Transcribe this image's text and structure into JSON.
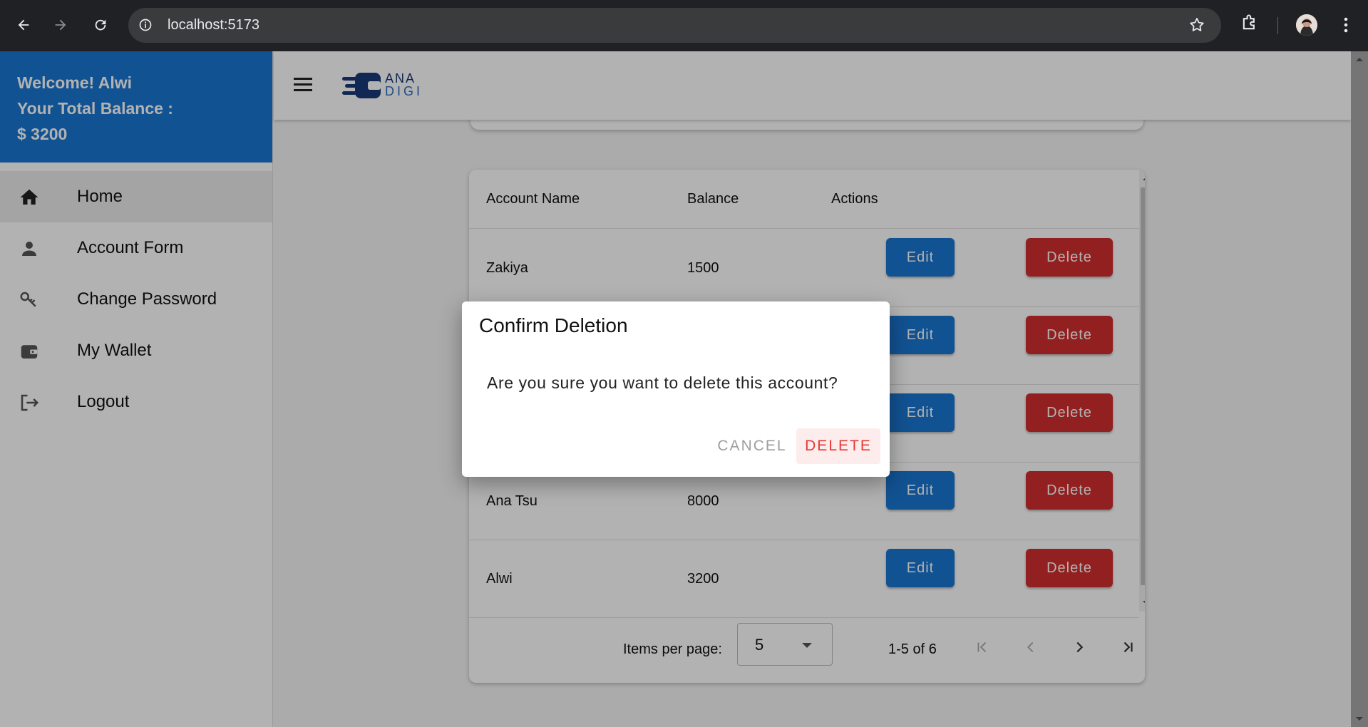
{
  "browser": {
    "url": "localhost:5173"
  },
  "sidebar": {
    "welcome": "Welcome! Alwi",
    "balance_label": "Your Total Balance :",
    "balance_value": "$ 3200",
    "items": [
      {
        "label": "Home",
        "icon": "home-icon",
        "active": true
      },
      {
        "label": "Account Form",
        "icon": "person-icon"
      },
      {
        "label": "Change Password",
        "icon": "key-icon"
      },
      {
        "label": "My Wallet",
        "icon": "wallet-icon"
      },
      {
        "label": "Logout",
        "icon": "logout-icon"
      }
    ]
  },
  "logo": {
    "line1": "ANA",
    "line2": "DIGI"
  },
  "table": {
    "headers": [
      "Account Name",
      "Balance",
      "Actions"
    ],
    "rows": [
      {
        "name": "Zakiya",
        "balance": "1500"
      },
      {
        "name": "",
        "balance": ""
      },
      {
        "name": "",
        "balance": ""
      },
      {
        "name": "Ana Tsu",
        "balance": "8000"
      },
      {
        "name": "Alwi",
        "balance": "3200"
      }
    ],
    "edit_label": "Edit",
    "delete_label": "Delete"
  },
  "pagination": {
    "items_per_page_label": "Items per page:",
    "items_per_page_value": "5",
    "range": "1-5 of 6"
  },
  "dialog": {
    "title": "Confirm Deletion",
    "message": "Are you sure you want to delete this account?",
    "cancel": "CANCEL",
    "confirm": "DELETE"
  },
  "colors": {
    "primary": "#1976d2",
    "danger": "#d32f2f"
  }
}
